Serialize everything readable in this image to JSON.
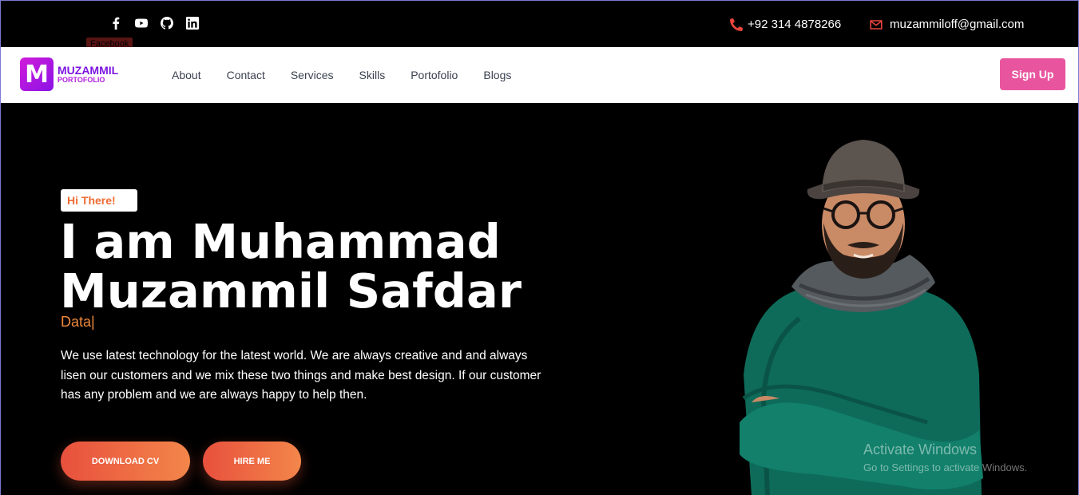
{
  "topbar": {
    "social": [
      "facebook-icon",
      "youtube-icon",
      "github-icon",
      "linkedin-icon"
    ],
    "tooltip": "Facebook",
    "phone": "+92 314 4878266",
    "email": "muzammiloff@gmail.com"
  },
  "navbar": {
    "logo_letter": "M",
    "logo_line1": "MUZAMMIL",
    "logo_line2": "PORTOFOLIO",
    "links": [
      "About",
      "Contact",
      "Services",
      "Skills",
      "Portofolio",
      "Blogs"
    ],
    "signup": "Sign Up"
  },
  "hero": {
    "badge": "Hi There!",
    "headline_line1": "I am Muhammad",
    "headline_line2": "Muzammil Safdar",
    "typed_text": "Data",
    "caret": "|",
    "intro": "We use latest technology for the latest world. We are always creative and and always lisen our customers and we mix these two things and make best design. If our customer has any problem and we are always happy to help then.",
    "btn_download": "DOWNLOAD CV",
    "btn_hire": "HIRE ME"
  },
  "watermark": {
    "line1": "Activate Windows",
    "line2": "Go to Settings to activate Windows."
  },
  "colors": {
    "accent_orange": "#f08a3c",
    "signup_pink": "#e8559e",
    "logo_purple": "#8a12e6"
  }
}
